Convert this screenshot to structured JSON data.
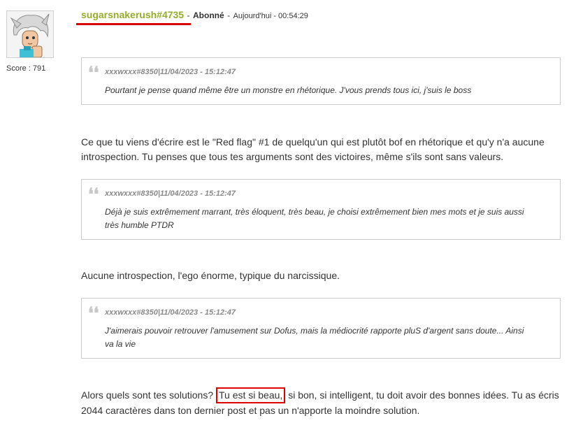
{
  "user": {
    "name": "sugarsnakerush#4735",
    "separator": "-",
    "role": "Abonné",
    "separator2": "-",
    "date": "Aujourd'hui - 00:54:29",
    "score_label": "Score :",
    "score_value": "791"
  },
  "post": {
    "quotes": [
      {
        "author": "xxxwxxx#8350|11/04/2023 - 15:12:47",
        "text": "Pourtant je pense quand même être un monstre en rhétorique. J'vous prends tous ici, j'suis le boss"
      },
      {
        "author": "xxxwxxx#8350|11/04/2023 - 15:12:47",
        "text": "Déjà je suis extrêmement marrant, très éloquent, très beau, je choisi extrêmement bien mes mots et je suis aussi très humble PTDR"
      },
      {
        "author": "xxxwxxx#8350|11/04/2023 - 15:12:47",
        "text": "J'aimerais pouvoir retrouver l'amusement sur Dofus, mais la médiocrité rapporte pluS d'argent sans doute... Ainsi va la vie"
      }
    ],
    "paragraphs": [
      "Ce que tu viens d'écrire est le \"Red flag\" #1 de quelqu'un qui est plutôt bof en rhétorique et qu'y n'a aucune introspection. Tu penses que tous tes arguments sont des victoires, même s'ils sont sans valeurs.",
      "Aucune introspection, l'ego énorme, typique du narcissique."
    ],
    "last_paragraph": {
      "before": "Alors quels sont tes solutions? ",
      "highlight": "Tu est si beau,",
      "after": " si bon, si intelligent, tu doit avoir des bonnes idées. Tu as écris 2044 caractères dans ton dernier post et pas un n'apporte la moindre solution."
    },
    "quote_mark": "❛❛"
  },
  "colors": {
    "username": "#95ad28",
    "annotation": "#e00000"
  }
}
